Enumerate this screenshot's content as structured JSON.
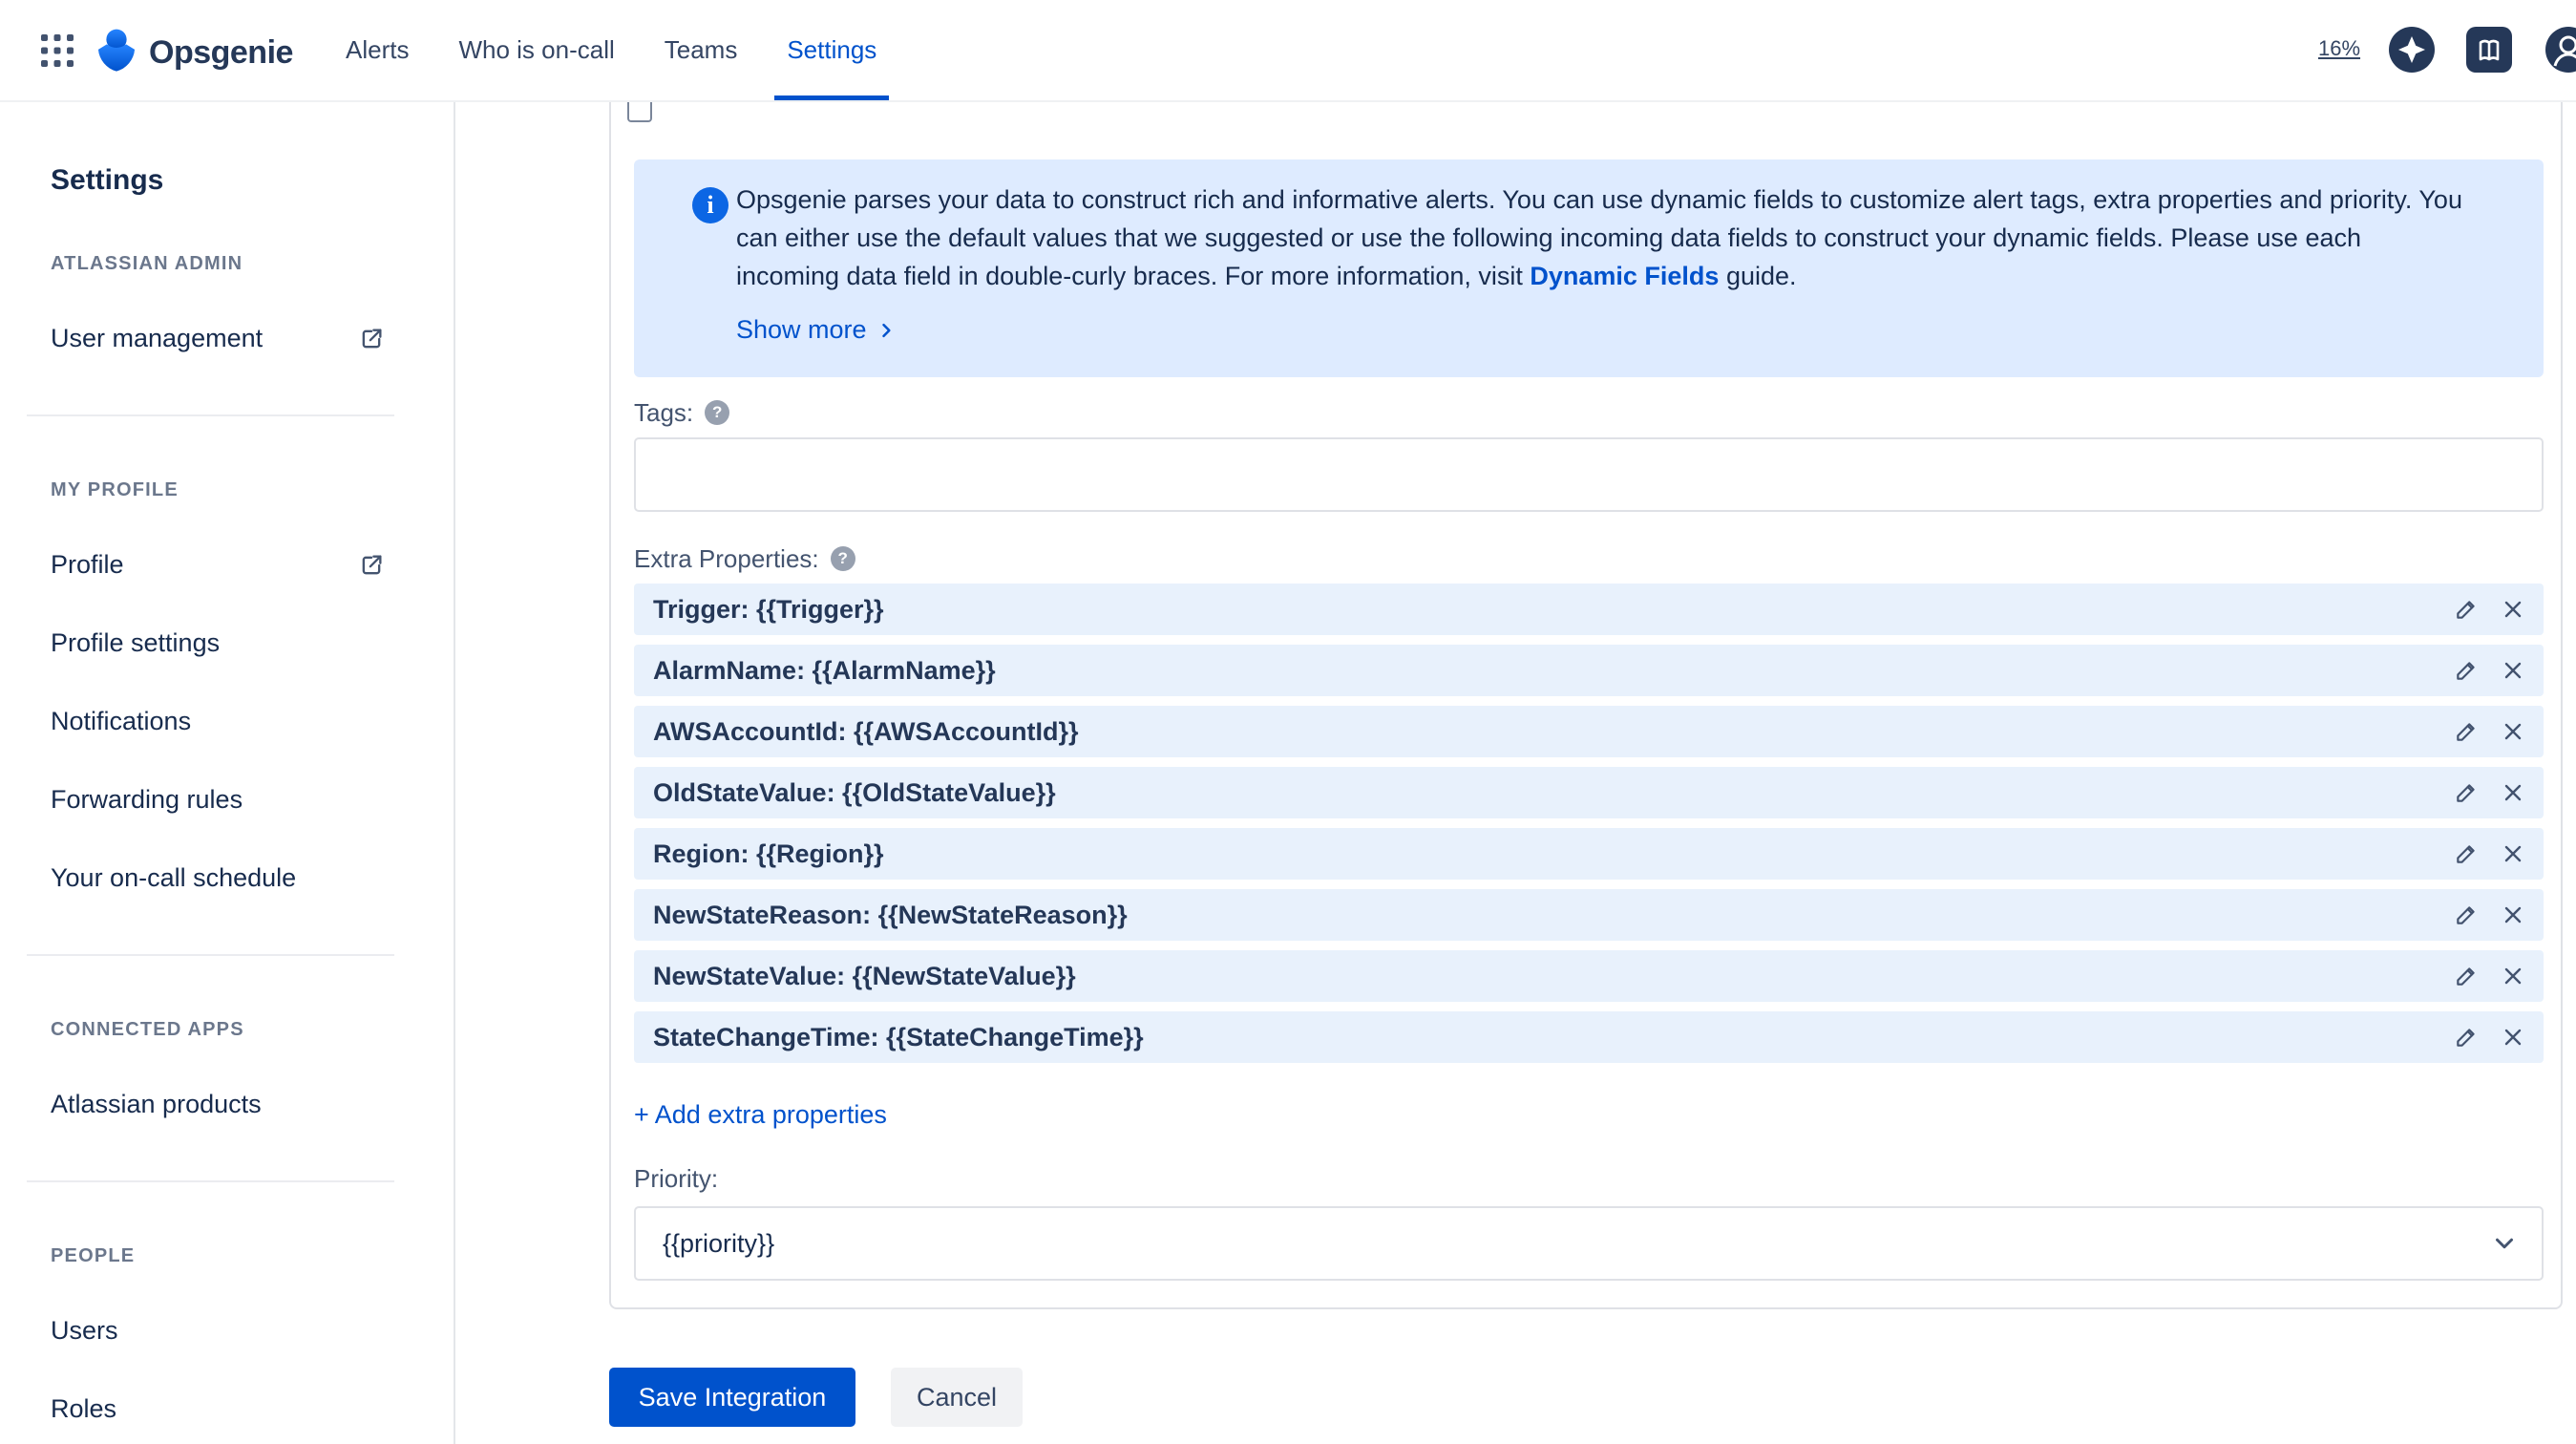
{
  "topbar": {
    "product_name": "Opsgenie",
    "nav": [
      {
        "label": "Alerts",
        "active": false
      },
      {
        "label": "Who is on-call",
        "active": false
      },
      {
        "label": "Teams",
        "active": false
      },
      {
        "label": "Settings",
        "active": true
      }
    ],
    "zoom_level": "16%"
  },
  "sidebar": {
    "title": "Settings",
    "sections": [
      {
        "label": "ATLASSIAN ADMIN",
        "items": [
          {
            "label": "User management",
            "external": true
          }
        ]
      },
      {
        "label": "MY PROFILE",
        "items": [
          {
            "label": "Profile",
            "external": true
          },
          {
            "label": "Profile settings",
            "external": false
          },
          {
            "label": "Notifications",
            "external": false
          },
          {
            "label": "Forwarding rules",
            "external": false
          },
          {
            "label": "Your on-call schedule",
            "external": false
          }
        ]
      },
      {
        "label": "CONNECTED APPS",
        "items": [
          {
            "label": "Atlassian products",
            "external": false
          }
        ]
      },
      {
        "label": "PEOPLE",
        "items": [
          {
            "label": "Users",
            "external": false
          },
          {
            "label": "Roles",
            "external": false
          }
        ]
      }
    ]
  },
  "main": {
    "info": {
      "text_before_link": "Opsgenie parses your data to construct rich and informative alerts. You can use dynamic fields to customize alert tags, extra properties and priority. You can either use the default values that we suggested or use the following incoming data fields to construct your dynamic fields. Please use each incoming data field in double-curly braces. For more information, visit ",
      "link_text": "Dynamic Fields",
      "text_after_link": " guide.",
      "show_more_label": "Show more"
    },
    "tags": {
      "label": "Tags:",
      "value": ""
    },
    "extra_properties": {
      "label": "Extra Properties:",
      "rows": [
        "Trigger: {{Trigger}}",
        "AlarmName: {{AlarmName}}",
        "AWSAccountId: {{AWSAccountId}}",
        "OldStateValue: {{OldStateValue}}",
        "Region: {{Region}}",
        "NewStateReason: {{NewStateReason}}",
        "NewStateValue: {{NewStateValue}}",
        "StateChangeTime: {{StateChangeTime}}"
      ],
      "add_label": "+ Add extra properties"
    },
    "priority": {
      "label": "Priority:",
      "value": "{{priority}}"
    },
    "buttons": {
      "save": "Save Integration",
      "cancel": "Cancel"
    }
  },
  "colors": {
    "accent_blue": "#0052CC",
    "info_bg": "#DEEBFF",
    "property_row_bg": "#E8F1FC",
    "navy": "#253858"
  }
}
